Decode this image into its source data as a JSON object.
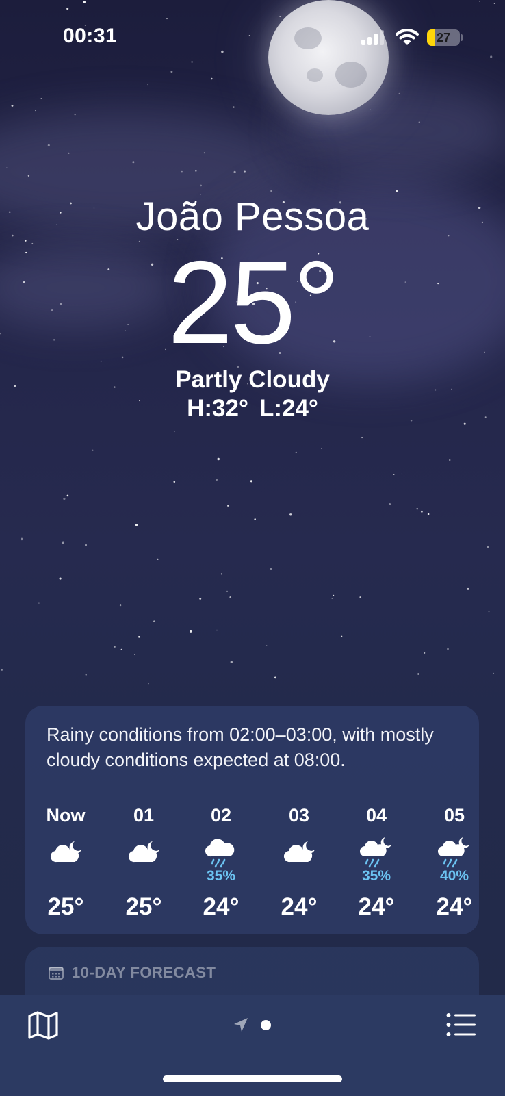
{
  "status_bar": {
    "time": "00:31",
    "battery_level": "27",
    "battery_color": "#ffd60a",
    "icons": [
      "signal-icon",
      "wifi-icon",
      "battery-icon"
    ]
  },
  "location": {
    "city": "João Pessoa",
    "temperature": "25°",
    "condition": "Partly Cloudy",
    "high": "H:32°",
    "low": "L:24°"
  },
  "hourly": {
    "summary": "Rainy conditions from 02:00–03:00, with mostly cloudy conditions expected at 08:00.",
    "precip_color": "#6cc4f2",
    "items": [
      {
        "label": "Now",
        "icon": "partly-cloudy-night-icon",
        "pop": "",
        "temp": "25°"
      },
      {
        "label": "01",
        "icon": "partly-cloudy-night-icon",
        "pop": "",
        "temp": "25°"
      },
      {
        "label": "02",
        "icon": "rain-icon",
        "pop": "35%",
        "temp": "24°"
      },
      {
        "label": "03",
        "icon": "partly-cloudy-night-icon",
        "pop": "",
        "temp": "24°"
      },
      {
        "label": "04",
        "icon": "rain-night-icon",
        "pop": "35%",
        "temp": "24°"
      },
      {
        "label": "05",
        "icon": "rain-night-icon",
        "pop": "40%",
        "temp": "24°"
      }
    ]
  },
  "forecast": {
    "header": "10-DAY FORECAST",
    "icon": "calendar-icon"
  },
  "toolbar": {
    "icons": [
      "map-icon",
      "location-arrow-icon",
      "page-dot",
      "list-icon"
    ]
  }
}
